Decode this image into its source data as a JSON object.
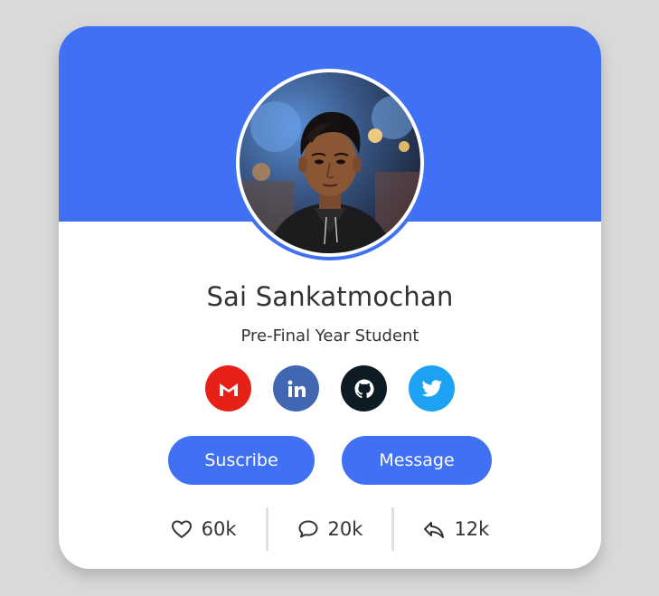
{
  "profile": {
    "name": "Sai Sankatmochan",
    "role": "Pre-Final Year Student"
  },
  "socials": [
    {
      "name": "gmail",
      "icon": "gmail-icon",
      "color": "#e62117"
    },
    {
      "name": "linkedin",
      "icon": "linkedin-icon",
      "color": "#4267b2"
    },
    {
      "name": "github",
      "icon": "github-icon",
      "color": "#0d1b24"
    },
    {
      "name": "twitter",
      "icon": "twitter-icon",
      "color": "#1da1f2"
    }
  ],
  "buttons": {
    "subscribe_label": "Suscribe",
    "message_label": "Message"
  },
  "stats": {
    "likes": "60k",
    "comments": "20k",
    "shares": "12k"
  },
  "colors": {
    "accent": "#4070f4",
    "background": "#d9d9d9",
    "text": "#333333"
  }
}
